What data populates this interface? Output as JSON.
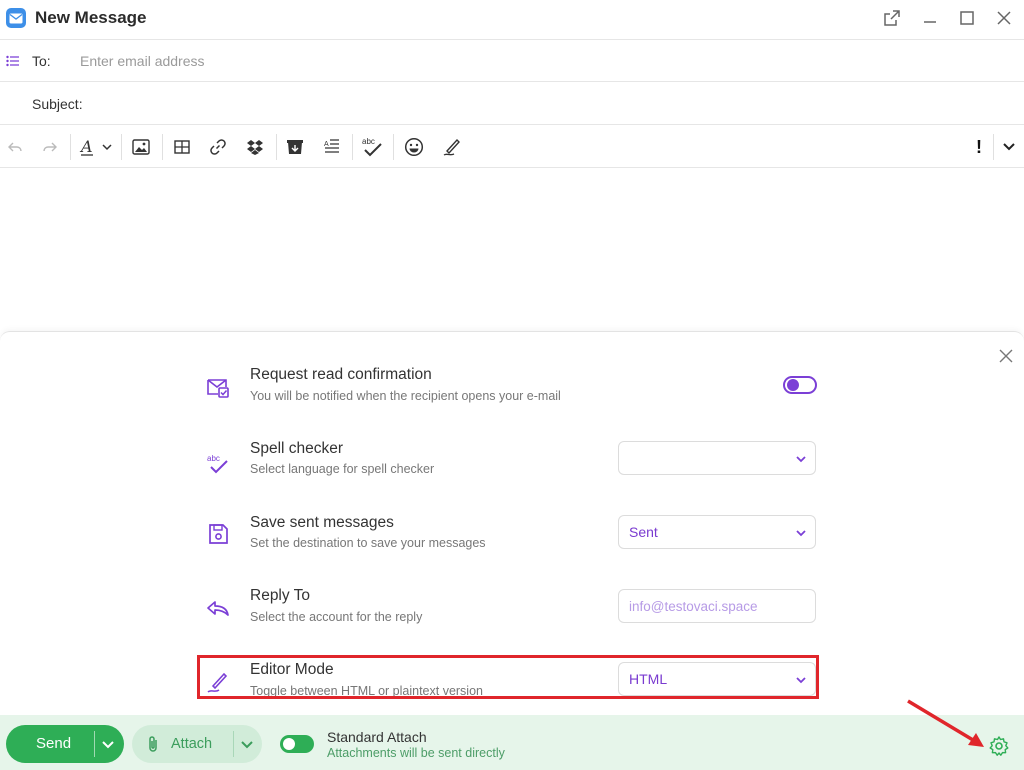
{
  "window": {
    "title": "New Message",
    "controls": [
      "popout-icon",
      "minimize-icon",
      "maximize-icon",
      "close-icon"
    ]
  },
  "header": {
    "to_label": "To:",
    "to_placeholder": "Enter email address",
    "to_value": "",
    "subject_label": "Subject:",
    "subject_value": ""
  },
  "toolbar": {
    "icons": [
      "undo-icon",
      "redo-icon",
      "text-format-icon",
      "insert-image-icon",
      "table-icon",
      "link-icon",
      "dropbox-icon",
      "archive-icon",
      "text-direction-icon",
      "spellcheck-icon",
      "emoji-icon",
      "signature-icon",
      "priority-icon",
      "more-icon"
    ],
    "priority_label": "!"
  },
  "settings": {
    "options": [
      {
        "title": "Request read confirmation",
        "desc": "You will be notified when the recipient opens your e-mail",
        "control": "toggle",
        "value": ""
      },
      {
        "title": "Spell checker",
        "desc": "Select language for spell checker",
        "control": "select",
        "value": ""
      },
      {
        "title": "Save sent messages",
        "desc": "Set the destination to save your messages",
        "control": "select",
        "value": "Sent"
      },
      {
        "title": "Reply To",
        "desc": "Select the account for the reply",
        "control": "field",
        "value": "info@testovaci.space"
      },
      {
        "title": "Editor Mode",
        "desc": "Toggle between HTML or plaintext version",
        "control": "select",
        "value": "HTML"
      }
    ]
  },
  "bottom": {
    "send_label": "Send",
    "attach_label": "Attach",
    "standard_attach_title": "Standard Attach",
    "standard_attach_desc": "Attachments will be sent directly"
  },
  "colors": {
    "accent": "#7b3fd6",
    "send_green": "#2eae56",
    "bottom_bg": "#e6f5ea",
    "highlight": "#e0262b"
  }
}
